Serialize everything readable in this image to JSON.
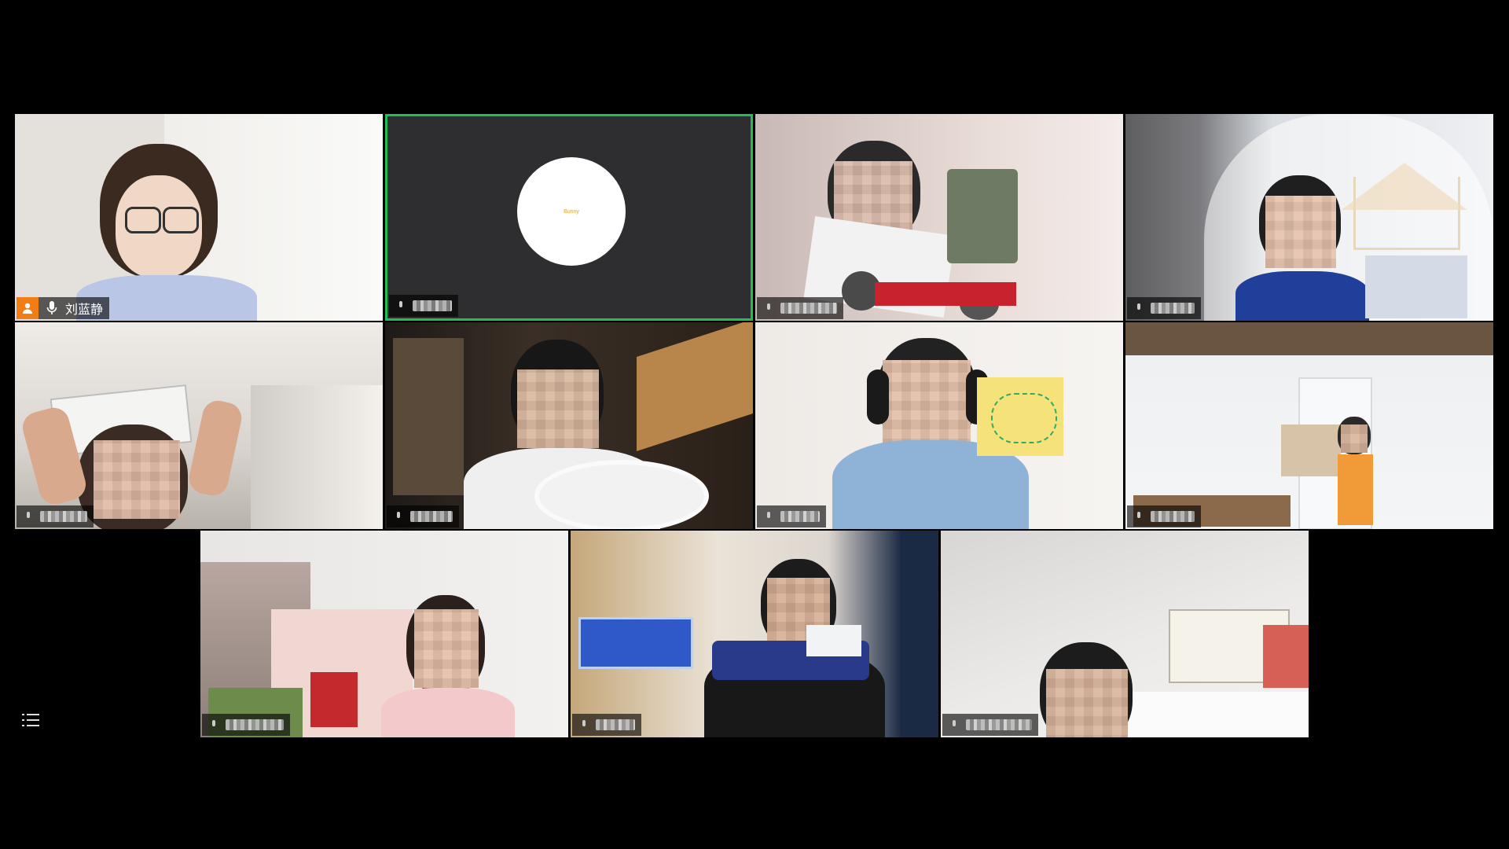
{
  "window": {
    "background": "#000000"
  },
  "host": {
    "name": "刘蓝静"
  },
  "active_speaker_color": "#1fbf57",
  "host_badge_color": "#f07d15",
  "avatar": {
    "label": "Bunny"
  },
  "participants": [
    {
      "id": "host",
      "is_host": true,
      "active": false
    },
    {
      "id": "p2",
      "is_host": false,
      "active": true,
      "video_off": true
    },
    {
      "id": "p3",
      "is_host": false,
      "active": false
    },
    {
      "id": "p4",
      "is_host": false,
      "active": false
    },
    {
      "id": "p5",
      "is_host": false,
      "active": false
    },
    {
      "id": "p6",
      "is_host": false,
      "active": false
    },
    {
      "id": "p7",
      "is_host": false,
      "active": false
    },
    {
      "id": "p8",
      "is_host": false,
      "active": false
    },
    {
      "id": "p9",
      "is_host": false,
      "active": false
    },
    {
      "id": "p10",
      "is_host": false,
      "active": false
    },
    {
      "id": "p11",
      "is_host": false,
      "active": false
    }
  ],
  "icons": {
    "host": "person-icon",
    "mic": "microphone-icon",
    "menu": "list-menu-icon"
  }
}
